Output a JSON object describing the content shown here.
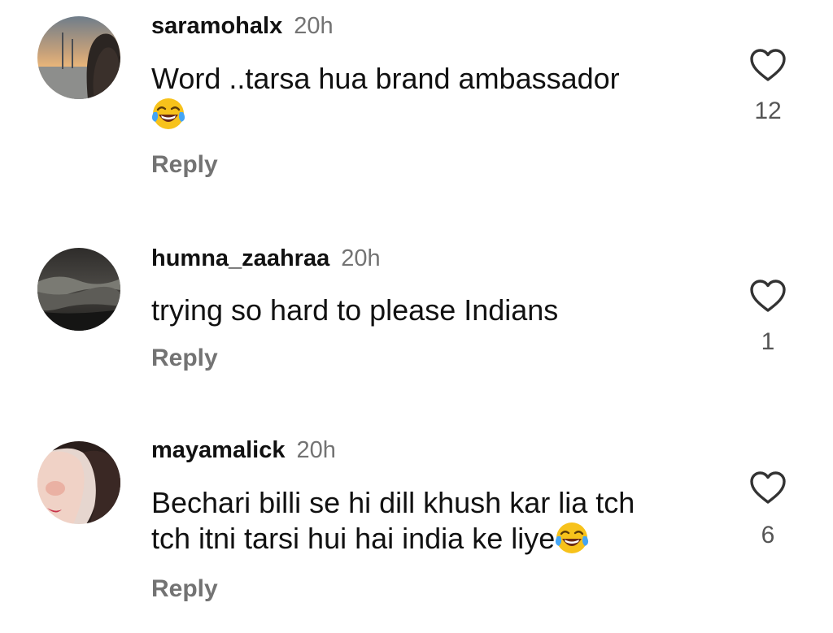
{
  "comments": [
    {
      "username": "saramohalx",
      "time": "20h",
      "text_line1": "Word ..tarsa hua brand ambassador",
      "text_line2": "",
      "emoji": "face-with-tears-of-joy",
      "reply_label": "Reply",
      "likes": "12",
      "avatar": "sunset-street-photo"
    },
    {
      "username": "humna_zaahraa",
      "time": "20h",
      "text_line1": "trying so hard to please Indians",
      "reply_label": "Reply",
      "likes": "1",
      "avatar": "dark-ocean-wave-photo"
    },
    {
      "username": "mayamalick",
      "time": "20h",
      "text_line1": "Bechari billi se hi dill khush kar lia tch",
      "text_line2": "tch itni tarsi hui hai india ke liye",
      "emoji": "face-with-tears-of-joy",
      "reply_label": "Reply",
      "likes": "6",
      "avatar": "portrait-photo"
    }
  ],
  "colors": {
    "text": "#111111",
    "secondary": "#737373",
    "count": "#555555",
    "background": "#ffffff"
  }
}
